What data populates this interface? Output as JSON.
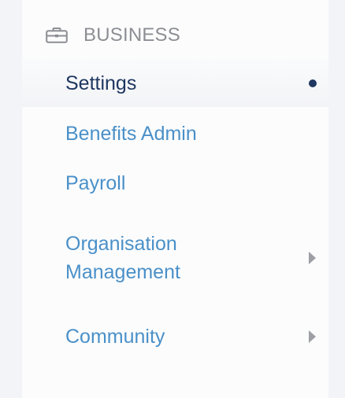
{
  "section": {
    "title": "BUSINESS",
    "icon": "briefcase-icon"
  },
  "nav": {
    "items": [
      {
        "label": "Settings",
        "active": true
      },
      {
        "label": "Benefits Admin",
        "active": false
      },
      {
        "label": "Payroll",
        "active": false
      },
      {
        "label": "Organisation Management",
        "active": false,
        "expandable": true
      },
      {
        "label": "Community",
        "active": false,
        "expandable": true
      }
    ]
  },
  "colors": {
    "link": "#4a90c8",
    "active": "#1f3761",
    "header": "#8c8e93",
    "caret": "#9d9fa4",
    "panel": "#fcfcfd",
    "page_background": "#f3f4f7"
  }
}
